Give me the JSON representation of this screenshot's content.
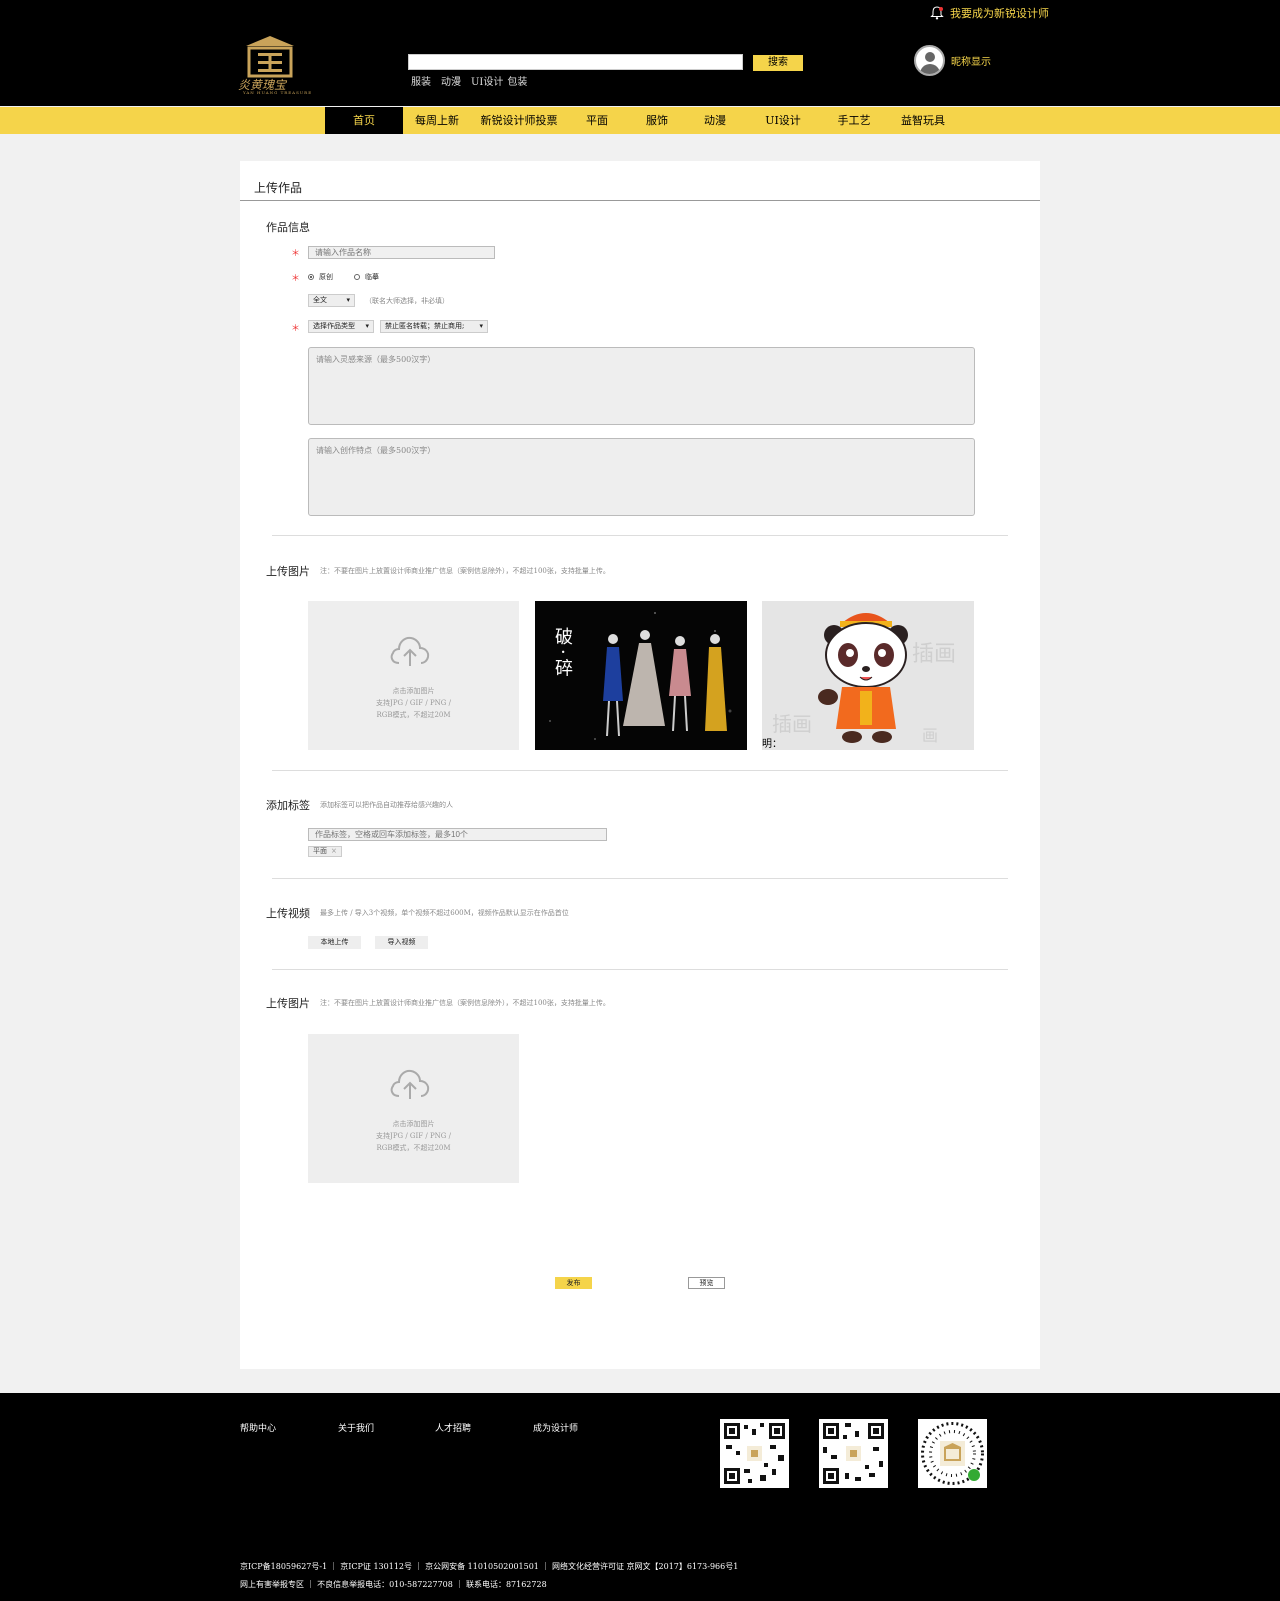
{
  "header": {
    "designer_link": "我要成为新锐设计师",
    "logo_text": "炎黄瑰宝",
    "logo_sub": "YAN HUANG TREASURE",
    "search_button": "搜索",
    "search_placeholder": "",
    "hot_tags": [
      "服装",
      "动漫",
      "UI设计",
      "包装"
    ],
    "nickname": "昵称显示"
  },
  "nav": {
    "items": [
      "首页",
      "每周上新",
      "新锐设计师投票",
      "平面",
      "服饰",
      "动漫",
      "UI设计",
      "手工艺",
      "益智玩具"
    ],
    "active_index": 0
  },
  "form": {
    "page_title": "上传作品",
    "info_title": "作品信息",
    "name_placeholder": "请输入作品名称",
    "radio_original": "原创",
    "radio_copy": "临摹",
    "master_select": "全文",
    "master_hint": "（联名大师选择，非必填）",
    "type_select": "选择作品类型",
    "license_select": "禁止匿名转载；禁止商用;",
    "inspiration_placeholder": "请输入灵感来源（最多500汉字）",
    "feature_placeholder": "请输入创作特点（最多500汉字）"
  },
  "upload_images": {
    "title": "上传图片",
    "hint": "注：不要在图片上放置设计师商业推广信息（案例信息除外），不超过100张，支持批量上传。",
    "box_line1": "点击添加图片",
    "box_line2": "支持JPG / GIF / PNG /",
    "box_line3": "RGB模式，不超过20M",
    "fashion_title": "破·碎",
    "panda_caption": "明："
  },
  "tags": {
    "title": "添加标签",
    "hint": "添加标签可以把作品自动推荐给感兴趣的人",
    "placeholder": "作品标签，空格或回车添加标签，最多10个",
    "chip": "平面",
    "chip_close": "×"
  },
  "video": {
    "title": "上传视频",
    "hint": "最多上传 / 导入3个视频，单个视频不超过600M，视频作品默认显示在作品首位",
    "local_button": "本地上传",
    "import_button": "导入视频"
  },
  "upload_images_2": {
    "title": "上传图片",
    "hint": "注：不要在图片上放置设计师商业推广信息（案例信息除外），不超过100张，支持批量上传。",
    "box_line1": "点击添加图片",
    "box_line2": "支持JPG / GIF / PNG /",
    "box_line3": "RGB模式，不超过20M"
  },
  "actions": {
    "publish": "发布",
    "preview": "预览"
  },
  "footer": {
    "links": [
      "帮助中心",
      "关于我们",
      "人才招聘",
      "成为设计师"
    ],
    "line1": "京ICP备18059627号-1 ｜ 京ICP证 130112号 ｜ 京公网安备 11010502001501 ｜ 网络文化经营许可证  京网文【2017】6173-966号1",
    "line2": "网上有害举报专区 ｜ 不良信息举报电话：010-587227708 ｜ 联系电话：87162728"
  },
  "colors": {
    "accent": "#f5d44a",
    "header_bg": "#000000",
    "page_bg": "#f1f1f1"
  }
}
